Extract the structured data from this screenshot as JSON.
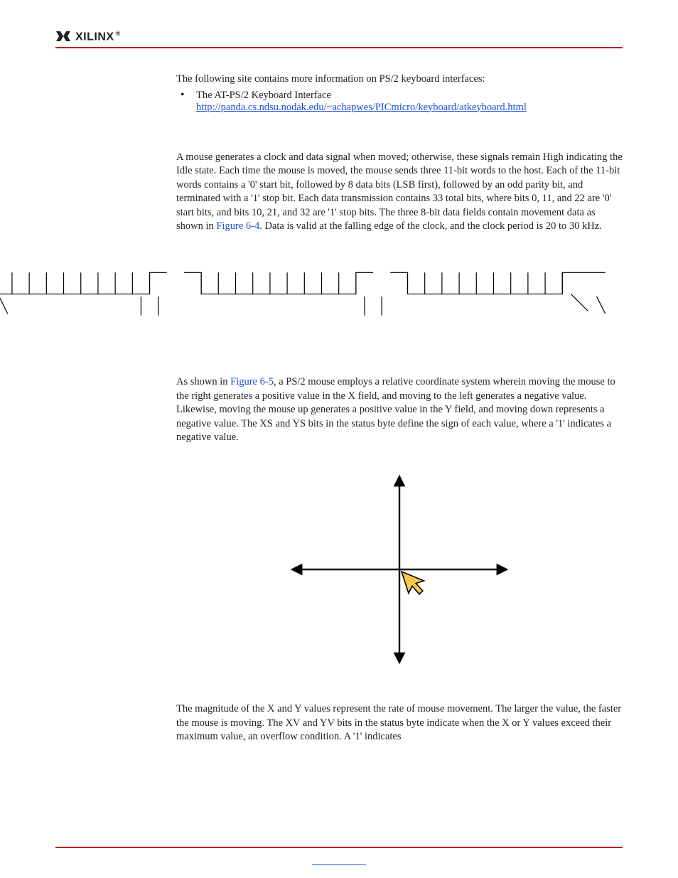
{
  "brand": {
    "name": "XILINX",
    "registered": "®"
  },
  "intro": "The following site contains more information on PS/2 keyboard interfaces:",
  "list_item_title": "The AT-PS/2 Keyboard Interface",
  "list_item_url": "http://panda.cs.ndsu.nodak.edu/~achapwes/PICmicro/keyboard/atkeyboard.html",
  "para_mouse_a": "A mouse generates a clock and data signal when moved; otherwise, these signals remain High indicating the Idle state. Each time the mouse is moved, the mouse sends three 11-bit words to the host. Each of the 11-bit words contains a '0' start bit, followed by 8 data bits (LSB first), followed by an odd parity bit, and terminated with a '1' stop bit. Each data transmission contains 33 total bits, where bits 0, 11, and 22 are '0' start bits, and bits 10, 21, and 32 are '1' stop bits. The three 8-bit data fields contain movement data as shown in ",
  "figref64": "Figure 6-4",
  "para_mouse_b": ". Data is valid at the falling edge of the clock, and the clock period is 20 to 30 kHz.",
  "para_coord_a": "As shown in ",
  "figref65": "Figure 6-5",
  "para_coord_b": ", a PS/2 mouse employs a relative coordinate system wherein moving the mouse to the right generates a positive value in the X field, and moving to the left generates a negative value. Likewise, moving the mouse up generates a positive value in the Y field, and moving down represents a negative value. The XS and YS bits in the status byte define the sign of each value, where a '1' indicates a negative value.",
  "para_mag": "The magnitude of the X and Y values represent the rate of mouse movement. The larger the value, the faster the mouse is moving. The XV and YV bits in the status byte indicate when the X or Y values exceed their maximum value, an overflow condition. A '1' indicates"
}
